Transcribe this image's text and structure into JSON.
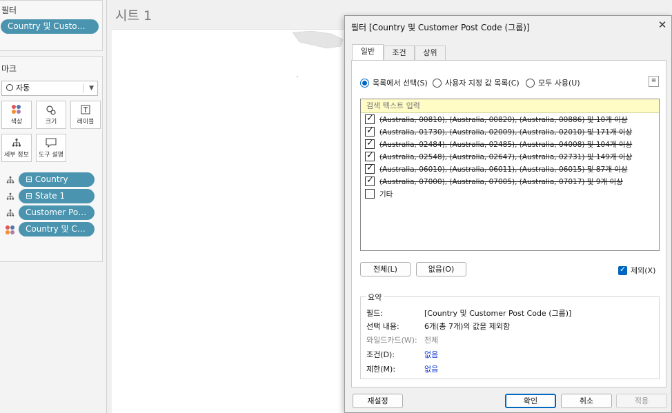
{
  "filters_panel": {
    "title": "필터",
    "pill": "Country 및 Customer.."
  },
  "marks_panel": {
    "title": "마크",
    "mark_type": "자동",
    "buttons": [
      {
        "label": "색상",
        "icon": "color-icon"
      },
      {
        "label": "크기",
        "icon": "size-icon"
      },
      {
        "label": "레이블",
        "icon": "label-icon"
      },
      {
        "label": "세부 정보",
        "icon": "detail-icon"
      },
      {
        "label": "도구 설명",
        "icon": "tooltip-icon"
      }
    ],
    "fields": [
      {
        "prefix": "⊟",
        "label": "Country",
        "icon": "hierarchy-icon"
      },
      {
        "prefix": "⊟",
        "label": "State 1",
        "icon": "hierarchy-icon"
      },
      {
        "prefix": "",
        "label": "Customer Post ..",
        "icon": "hierarchy-icon"
      },
      {
        "prefix": "",
        "label": "Country 및 Cus..",
        "icon": "color-icon"
      }
    ]
  },
  "sheet": {
    "title": "시트 1"
  },
  "dialog": {
    "title": "필터 [Country 및 Customer Post Code (그룹)]",
    "close_glyph": "✕",
    "tabs": [
      "일반",
      "조건",
      "상위"
    ],
    "radios": [
      {
        "label": "목록에서 선택(S)",
        "selected": true
      },
      {
        "label": "사용자 지정 값 목록(C)",
        "selected": false
      },
      {
        "label": "모두 사용(U)",
        "selected": false
      }
    ],
    "search_placeholder": "검색 텍스트 입력",
    "items": [
      {
        "text": "(Australia, 00810), (Australia, 00820), (Australia, 00886) 및 10개 이상",
        "checked": true
      },
      {
        "text": "(Australia, 01730), (Australia, 02009), (Australia, 02010) 및 171개 이상",
        "checked": true
      },
      {
        "text": "(Australia, 02484), (Australia, 02485), (Australia, 04008) 및 104개 이상",
        "checked": true
      },
      {
        "text": "(Australia, 02548), (Australia, 02647), (Australia, 02731) 및 149개 이상",
        "checked": true
      },
      {
        "text": "(Australia, 06010), (Australia, 06011), (Australia, 06015) 및 87개 이상",
        "checked": true
      },
      {
        "text": "(Australia, 07000), (Australia, 07005), (Australia, 07017) 및 9개 이상",
        "checked": true
      },
      {
        "text": "기타",
        "checked": false
      }
    ],
    "all_button": "전체(L)",
    "none_button": "없음(O)",
    "exclude_label": "제외(X)",
    "summary": {
      "legend": "요약",
      "rows": [
        {
          "label": "필드:",
          "value": "[Country 및 Customer Post Code (그룹)]",
          "style": ""
        },
        {
          "label": "선택 내용:",
          "value": "6개(총 7개)의 값을 제외함",
          "style": ""
        },
        {
          "label": "와일드카드(W):",
          "value": "전체",
          "style": "dim"
        },
        {
          "label": "조건(D):",
          "value": "없음",
          "style": "link"
        },
        {
          "label": "제한(M):",
          "value": "없음",
          "style": "link"
        }
      ]
    },
    "footer": {
      "reset": "재설정",
      "ok": "확인",
      "cancel": "취소",
      "apply": "적용"
    }
  }
}
